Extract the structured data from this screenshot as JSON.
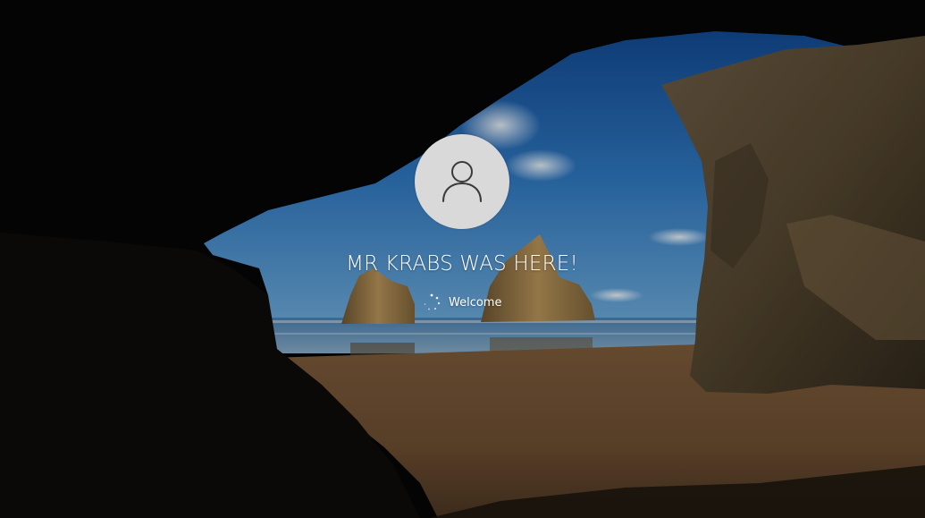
{
  "login": {
    "username": "MR KRABS WAS HERE!",
    "status": "Welcome",
    "avatar_icon": "user-icon",
    "spinner_icon": "loading-spinner-icon"
  },
  "colors": {
    "avatar_background": "#d9d9d9",
    "avatar_glyph": "#3a3a3a",
    "text": "#ffffff",
    "sky": "#1e5aa8",
    "sand": "#6e5133"
  }
}
